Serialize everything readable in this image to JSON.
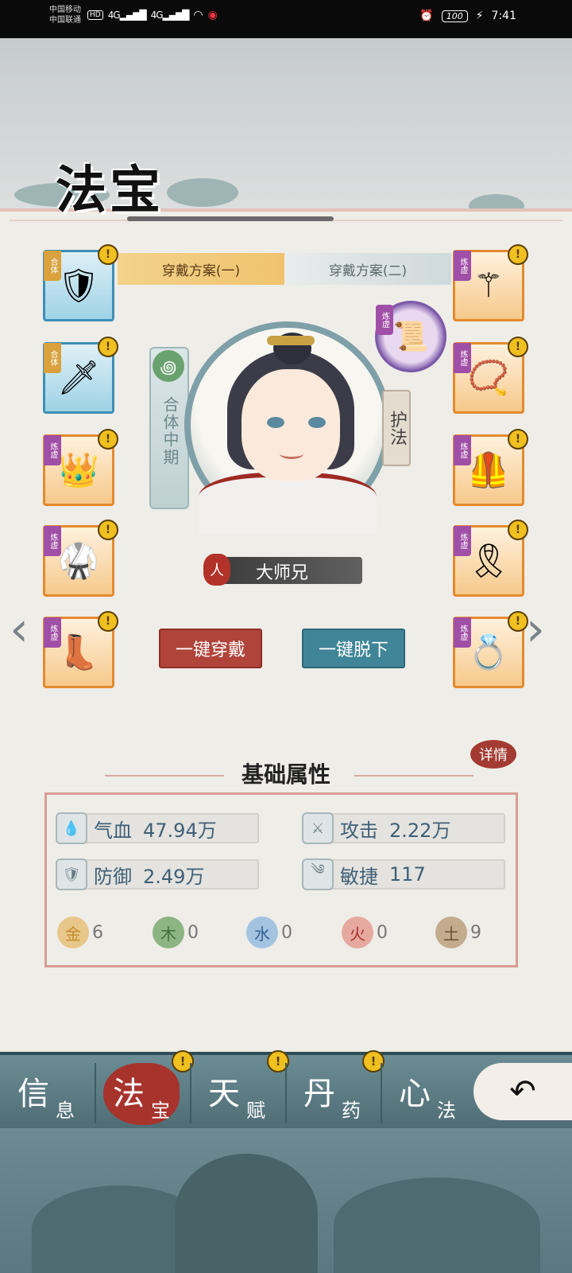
{
  "status_bar": {
    "carrier_1": "中国移动",
    "carrier_2": "中国联通",
    "hd": "HD",
    "net_1": "4G",
    "net_2": "4G",
    "battery": "100",
    "time": "7:41"
  },
  "page_title": "法宝",
  "tabs": [
    {
      "label": "穿戴方案(一)",
      "active": true
    },
    {
      "label": "穿戴方案(二)",
      "active": false
    }
  ],
  "left_slots": [
    {
      "tag": "合体",
      "icon": "gauntlet-icon",
      "glyph": "🛡",
      "rarity": "blue"
    },
    {
      "tag": "合体",
      "icon": "dagger-icon",
      "glyph": "🗡",
      "rarity": "blue"
    },
    {
      "tag": "炼虚",
      "icon": "crown-icon",
      "glyph": "👑",
      "rarity": "orange"
    },
    {
      "tag": "炼虚",
      "icon": "robe-icon",
      "glyph": "🥋",
      "rarity": "orange"
    },
    {
      "tag": "炼虚",
      "icon": "boots-icon",
      "glyph": "👢",
      "rarity": "orange"
    }
  ],
  "right_slots": [
    {
      "tag": "炼虚",
      "icon": "hairpin-icon",
      "glyph": "⚚",
      "rarity": "orange"
    },
    {
      "tag": "炼虚",
      "icon": "necklace-icon",
      "glyph": "📿",
      "rarity": "orange"
    },
    {
      "tag": "炼虚",
      "icon": "armor-icon",
      "glyph": "🦺",
      "rarity": "orange"
    },
    {
      "tag": "炼虚",
      "icon": "belt-icon",
      "glyph": "🎗",
      "rarity": "orange"
    },
    {
      "tag": "炼虚",
      "icon": "ring-icon",
      "glyph": "💍",
      "rarity": "orange"
    }
  ],
  "realm": {
    "label": "合体中期",
    "icon": "swirl-icon"
  },
  "guardian": {
    "label": "护法",
    "token_tag": "炼虚",
    "token_icon": "talisman-icon",
    "token_glyph": "📜"
  },
  "character": {
    "race": "人",
    "name": "大师兄"
  },
  "buttons": {
    "equip_all": "一键穿戴",
    "unequip_all": "一键脱下"
  },
  "attributes": {
    "section_title": "基础属性",
    "detail_label": "详情",
    "stats": [
      {
        "label": "气血",
        "value": "47.94万",
        "icon": "drop-icon",
        "glyph": "💧"
      },
      {
        "label": "攻击",
        "value": "2.22万",
        "icon": "attack-icon",
        "glyph": "⚔"
      },
      {
        "label": "防御",
        "value": "2.49万",
        "icon": "shield-icon",
        "glyph": "🛡"
      },
      {
        "label": "敏捷",
        "value": "117",
        "icon": "wind-icon",
        "glyph": "༄"
      }
    ],
    "elements": [
      {
        "name": "金",
        "value": "6",
        "color": "#e8c78a",
        "text_color": "#c48a2a"
      },
      {
        "name": "木",
        "value": "0",
        "color": "#8db483",
        "text_color": "#3f6e3c"
      },
      {
        "name": "水",
        "value": "0",
        "color": "#a3c3e1",
        "text_color": "#335f8c"
      },
      {
        "name": "火",
        "value": "0",
        "color": "#e5a9a0",
        "text_color": "#a8322a"
      },
      {
        "name": "土",
        "value": "9",
        "color": "#c3ab8e",
        "text_color": "#6a4e2f"
      }
    ]
  },
  "bottom_nav": [
    {
      "big": "信",
      "small": "息",
      "active": false,
      "badge": false
    },
    {
      "big": "法",
      "small": "宝",
      "active": true,
      "badge": true
    },
    {
      "big": "天",
      "small": "赋",
      "active": false,
      "badge": true
    },
    {
      "big": "丹",
      "small": "药",
      "active": false,
      "badge": true
    },
    {
      "big": "心",
      "small": "法",
      "active": false,
      "badge": false
    }
  ],
  "badge_glyph": "!",
  "back_icon": "back-arrow-icon",
  "back_glyph": "↶",
  "nav_arrows": {
    "left": "‹",
    "right": "›"
  }
}
